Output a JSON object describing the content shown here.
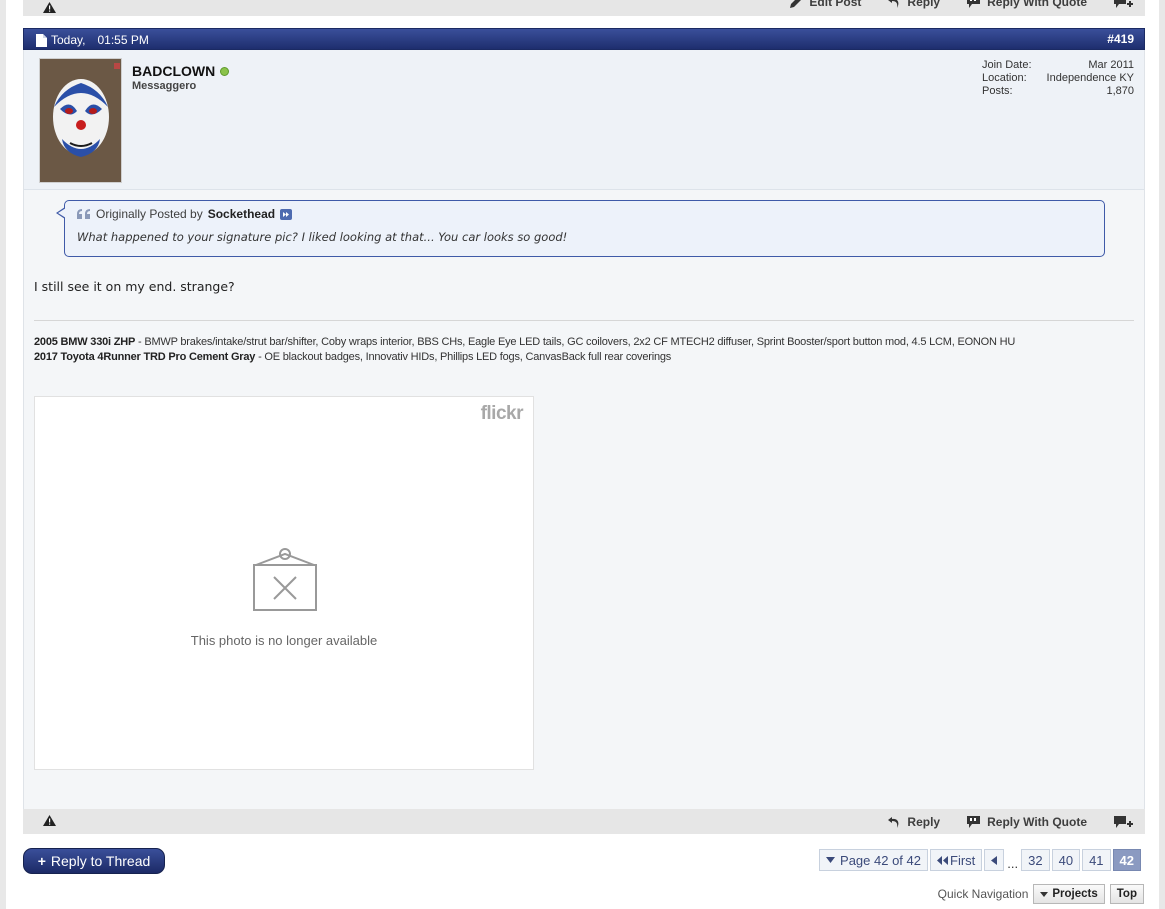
{
  "top_bar": {
    "edit_label": "Edit Post",
    "reply_label": "Reply",
    "reply_quote_label": "Reply With Quote"
  },
  "post": {
    "date": "Today,",
    "time": "01:55 PM",
    "number": "#419",
    "username": "BADCLOWN",
    "user_title": "Messaggero",
    "stats": [
      {
        "label": "Join Date:",
        "value": "Mar 2011"
      },
      {
        "label": "Location:",
        "value": "Independence KY"
      },
      {
        "label": "Posts:",
        "value": "1,870"
      }
    ],
    "quote": {
      "prefix": "Originally Posted by",
      "author": "Sockethead",
      "text": "What happened to your signature pic? I liked looking at that... You car looks so good!"
    },
    "message": "I still see it on my end. strange?",
    "signature": [
      {
        "title": "2005 BMW 330i ZHP",
        "details": " - BMWP brakes/intake/strut bar/shifter, Coby wraps interior, BBS CHs, Eagle Eye LED tails, GC coilovers, 2x2 CF MTECH2 diffuser, Sprint Booster/sport button mod, 4.5 LCM, EONON HU"
      },
      {
        "title": "2017 Toyota 4Runner TRD Pro Cement Gray",
        "details": " - OE blackout badges, Innovativ HIDs, Phillips LED fogs, CanvasBack full rear coverings"
      }
    ],
    "flickr": {
      "logo": "flickr",
      "message": "This photo is no longer available"
    }
  },
  "bottom_bar": {
    "reply_label": "Reply",
    "reply_quote_label": "Reply With Quote"
  },
  "reply_thread_label": "Reply to Thread",
  "reply_thread_plus": "+",
  "pagination": {
    "page_info": "Page 42 of 42",
    "first_label": "First",
    "ellipsis": "...",
    "pages": [
      "32",
      "40",
      "41"
    ],
    "current": "42"
  },
  "quick_nav": {
    "label": "Quick Navigation",
    "forum": "Projects",
    "top": "Top"
  }
}
